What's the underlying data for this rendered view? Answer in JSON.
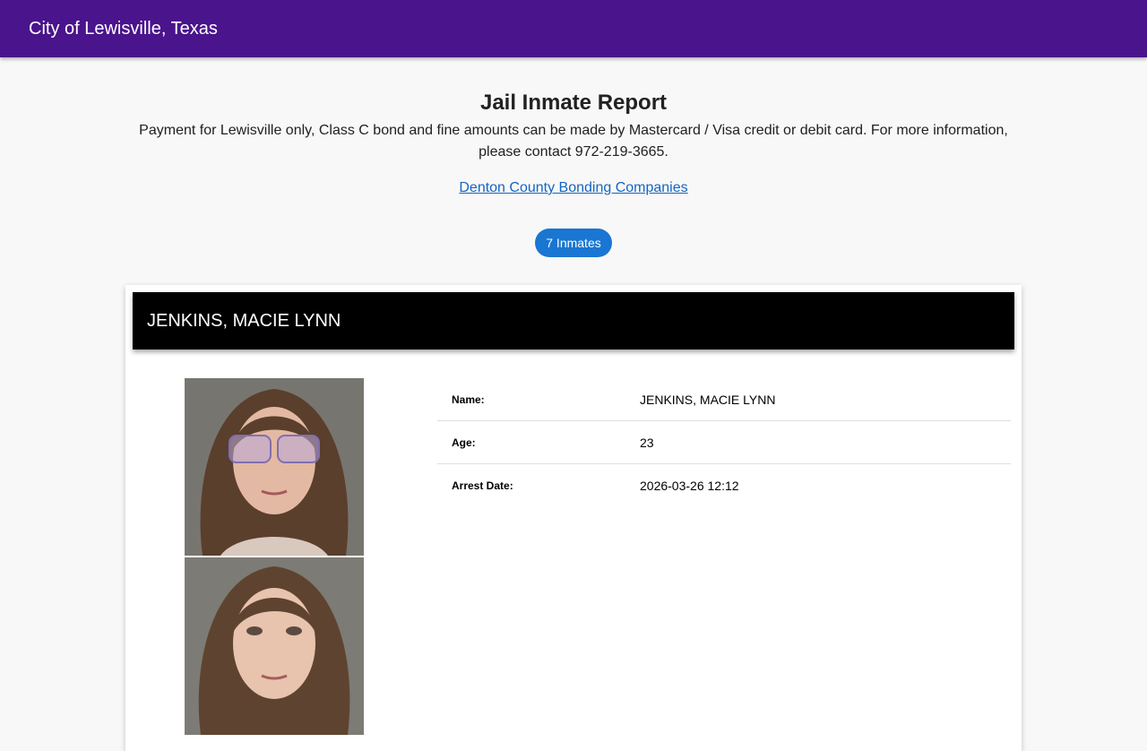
{
  "topbar": {
    "title": "City of Lewisville, Texas"
  },
  "header": {
    "title": "Jail Inmate Report",
    "intro": "Payment for Lewisville only, Class C bond and fine amounts can be made by Mastercard / Visa credit or debit card. For more information, please contact 972-219-3665.",
    "bonding_link": "Denton County Bonding Companies",
    "inmate_count": "7 Inmates"
  },
  "inmate": {
    "name_heading": "JENKINS, MACIE LYNN",
    "details": [
      {
        "label": "Name:",
        "value": "JENKINS, MACIE LYNN"
      },
      {
        "label": "Age:",
        "value": "23"
      },
      {
        "label": "Arrest Date:",
        "value": "2026-03-26 12:12"
      }
    ]
  },
  "colors": {
    "topbar": "#4a148c",
    "badge": "#1976d2",
    "link": "#1565c0",
    "card_header": "#000000"
  }
}
